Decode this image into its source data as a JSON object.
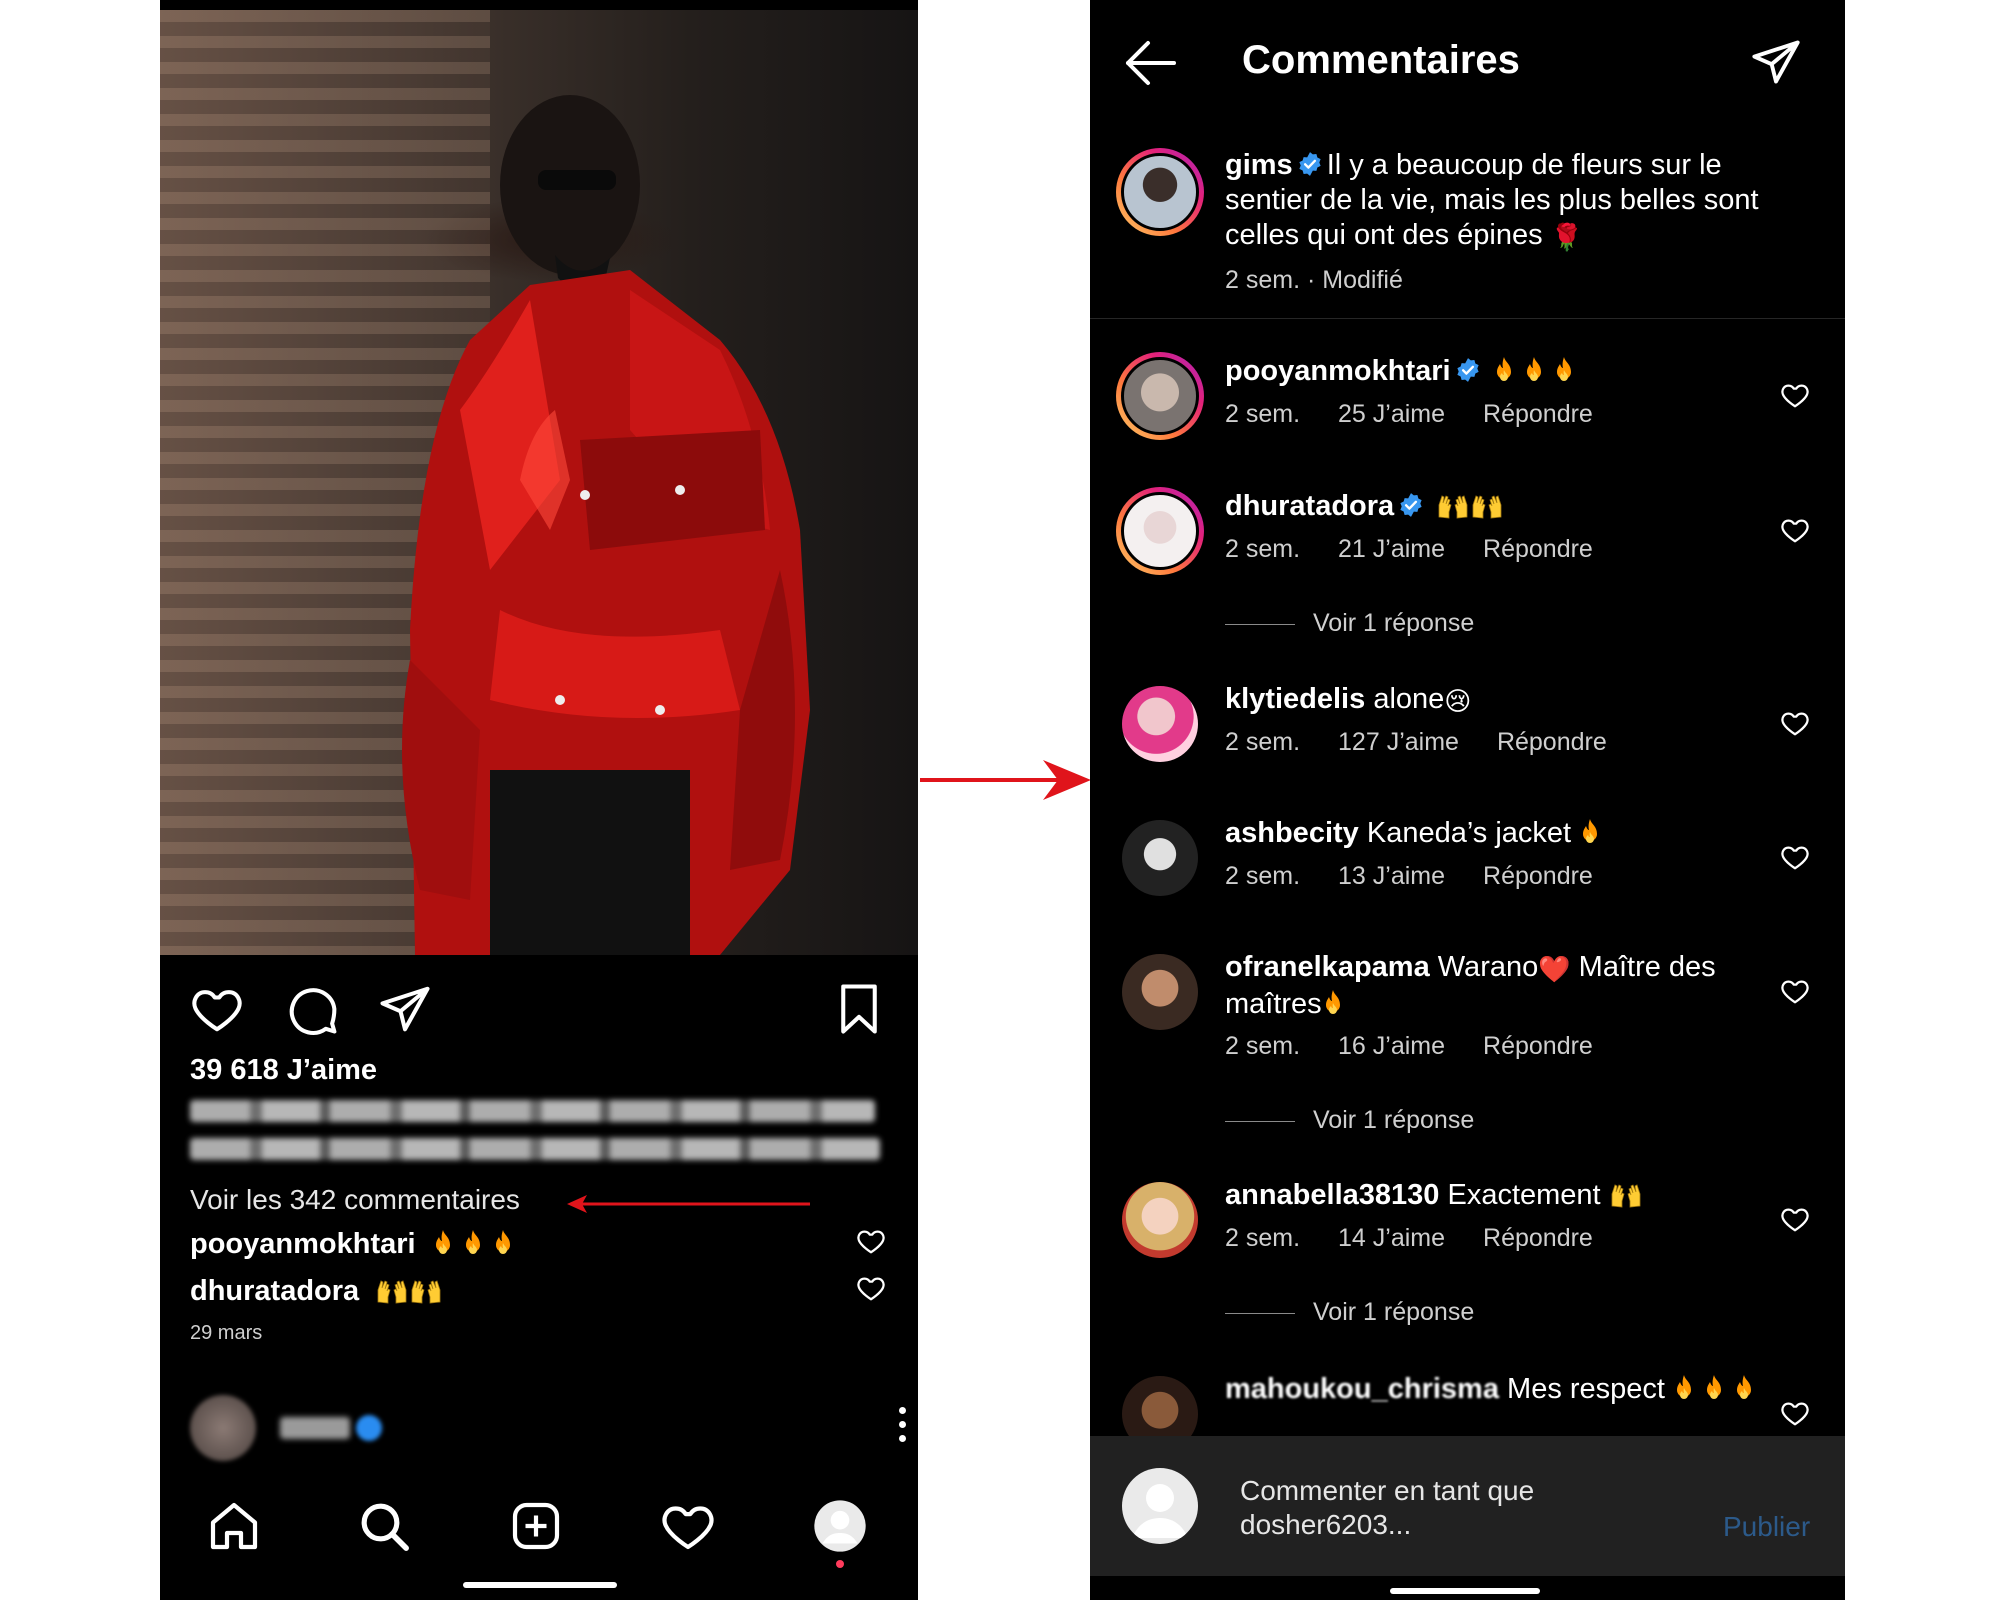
{
  "left_post": {
    "likes": "39 618 J’aime",
    "view_comments": "Voir les 342 commentaires",
    "preview_comments": [
      {
        "username": "pooyanmokhtari",
        "emoji": "fire-x3"
      },
      {
        "username": "dhuratadora",
        "emoji": "raised-hands-x2"
      }
    ],
    "date": "29 mars"
  },
  "comments_screen": {
    "title": "Commentaires",
    "caption": {
      "username": "gims",
      "text": "Il y a beaucoup de fleurs sur le sentier de la vie, mais les plus belles sont celles qui ont des épines",
      "emoji": "🌹",
      "time": "2 sem.",
      "edited": "· Modifié"
    },
    "reply_label": "Répondre",
    "comments": [
      {
        "username": "pooyanmokhtari",
        "text": "",
        "time": "2 sem.",
        "likes": "25 J’aime",
        "verified": true
      },
      {
        "username": "dhuratadora",
        "text": "",
        "time": "2 sem.",
        "likes": "21 J’aime",
        "verified": true,
        "replies": "Voir 1 réponse"
      },
      {
        "username": "klytiedelis",
        "text": "alone",
        "emoji": "😢",
        "time": "2 sem.",
        "likes": "127 J’aime"
      },
      {
        "username": "ashbecity",
        "text": "Kaneda’s jacket",
        "time": "2 sem.",
        "likes": "13 J’aime"
      },
      {
        "username": "ofranelkapama",
        "text": "Warano",
        "text2": "Maître des maîtres",
        "emoji": "❤️",
        "time": "2 sem.",
        "likes": "16 J’aime",
        "replies": "Voir 1 réponse"
      },
      {
        "username": "annabella38130",
        "text": "Exactement",
        "time": "2 sem.",
        "likes": "14 J’aime",
        "replies": "Voir 1 réponse"
      },
      {
        "username": "mahoukou_chrisma",
        "text": "Mes respect"
      }
    ],
    "composer": {
      "placeholder": "Commenter en tant que dosher6203...",
      "publish": "Publier"
    }
  },
  "colors": {
    "background": "#000000",
    "accent_red": "#e0141b",
    "verified_blue": "#3897f0",
    "publish_blue": "#2c5a8a",
    "composer_bg": "#212121"
  }
}
